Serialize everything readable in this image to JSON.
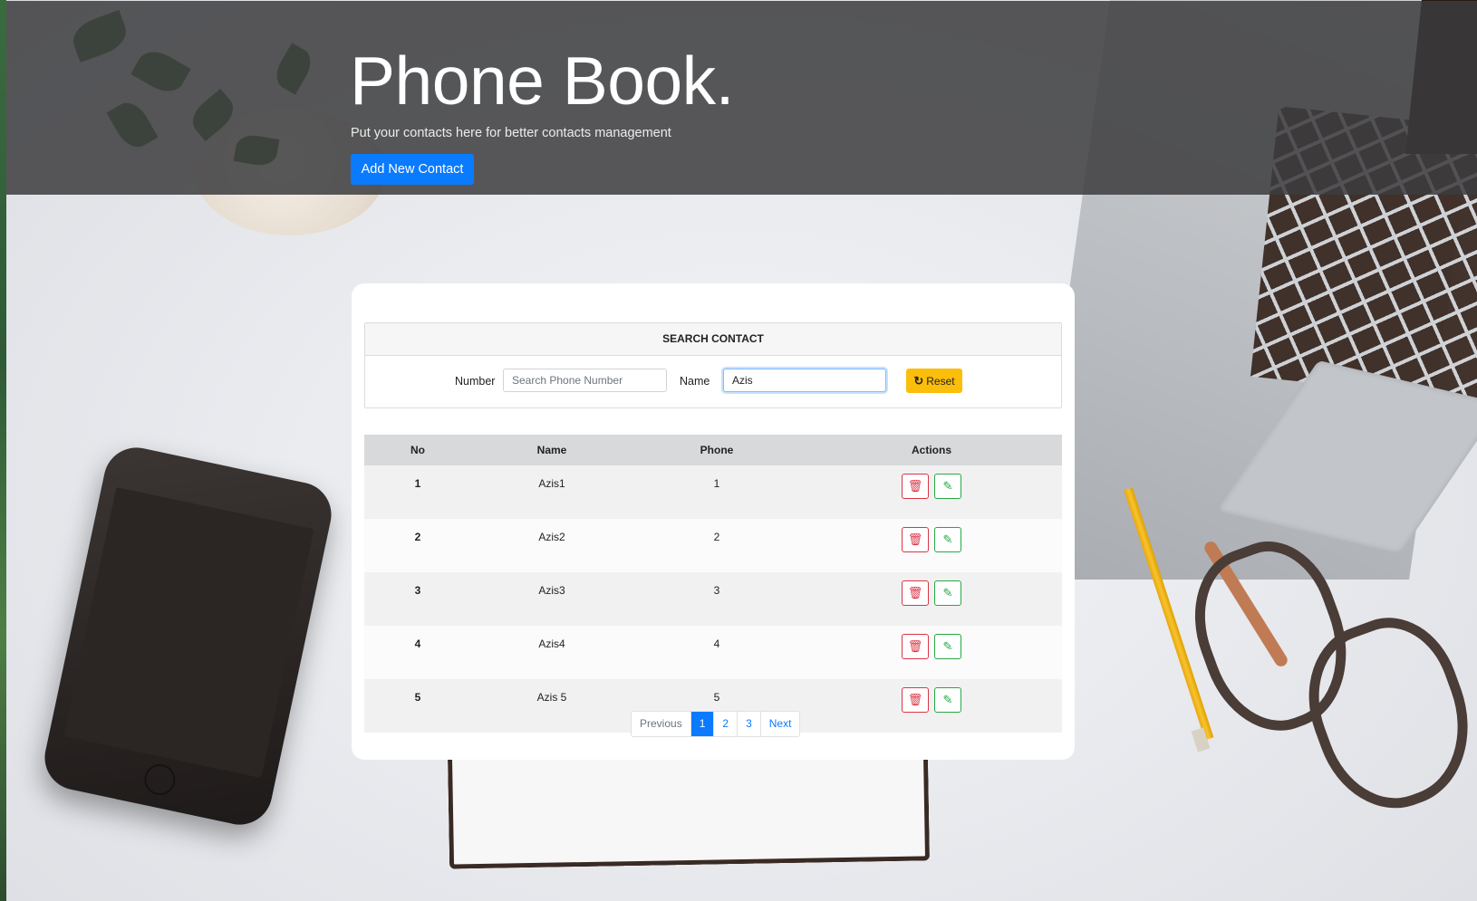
{
  "header": {
    "title": "Phone Book.",
    "subtitle": "Put your contacts here for better contacts management",
    "add_button": "Add New Contact"
  },
  "search": {
    "heading": "SEARCH CONTACT",
    "number_label": "Number",
    "number_placeholder": "Search Phone Number",
    "number_value": "",
    "name_label": "Name",
    "name_value": "Azis",
    "reset_label": "Reset",
    "reset_icon": "refresh-icon"
  },
  "table": {
    "columns": [
      "No",
      "Name",
      "Phone",
      "Actions"
    ],
    "rows": [
      {
        "no": "1",
        "name": "Azis1",
        "phone": "1"
      },
      {
        "no": "2",
        "name": "Azis2",
        "phone": "2"
      },
      {
        "no": "3",
        "name": "Azis3",
        "phone": "3"
      },
      {
        "no": "4",
        "name": "Azis4",
        "phone": "4"
      },
      {
        "no": "5",
        "name": "Azis 5",
        "phone": "5"
      }
    ],
    "delete_icon": "trash-icon",
    "edit_icon": "edit-icon"
  },
  "pagination": {
    "previous": "Previous",
    "pages": [
      "1",
      "2",
      "3"
    ],
    "active": "1",
    "next": "Next"
  },
  "colors": {
    "primary": "#0a7bff",
    "warning": "#fbbe0a",
    "danger": "#dc3545",
    "success": "#28a745"
  }
}
